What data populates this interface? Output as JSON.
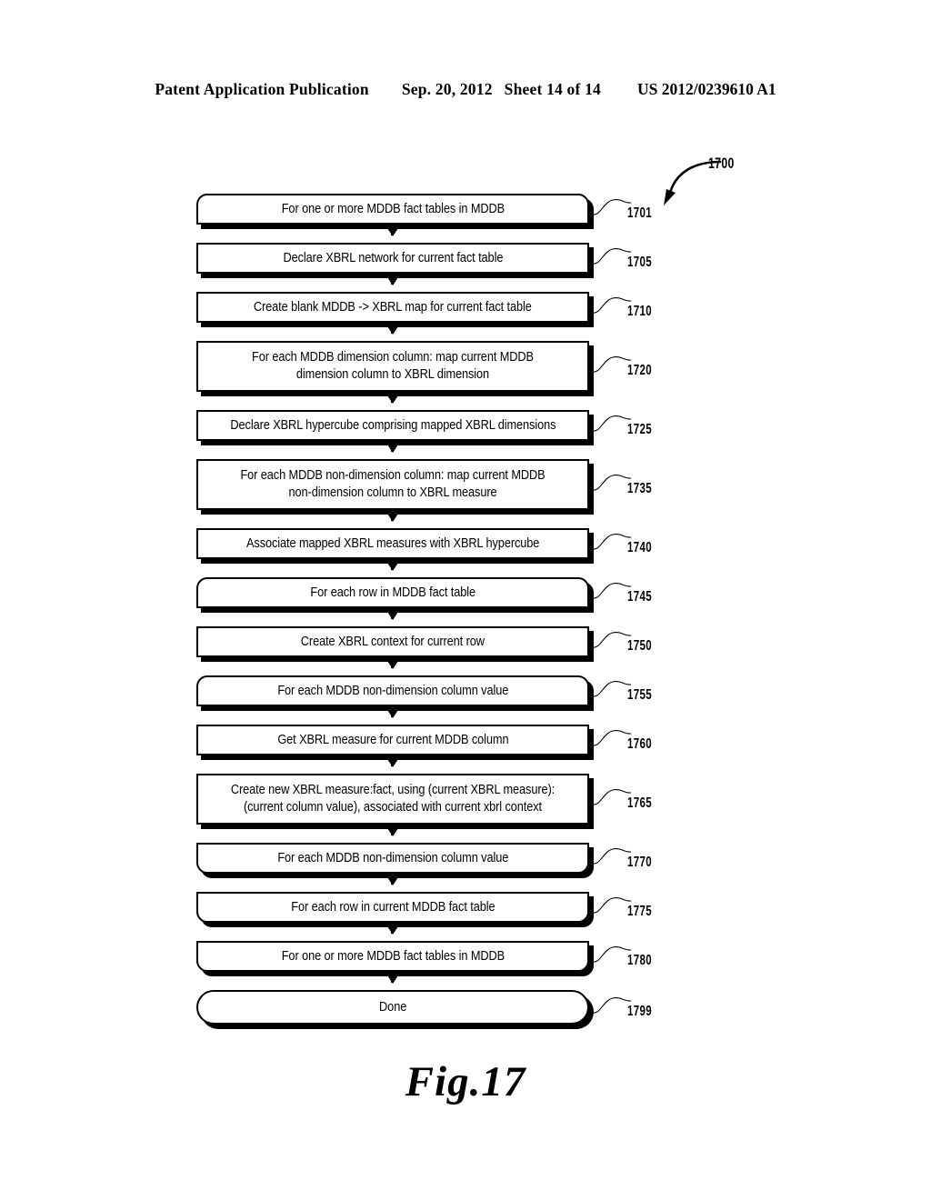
{
  "header": {
    "publication": "Patent Application Publication",
    "date": "Sep. 20, 2012",
    "sheet": "Sheet 14 of 14",
    "patent_number": "US 2012/0239610 A1"
  },
  "figure": {
    "caption": "Fig.17",
    "diagram_ref": "1700"
  },
  "flowchart": {
    "nodes": [
      {
        "ref": "1701",
        "shape": "loopstart",
        "text": "For one or more MDDB fact tables in MDDB"
      },
      {
        "ref": "1705",
        "shape": "rect",
        "text": "Declare XBRL network for current fact table"
      },
      {
        "ref": "1710",
        "shape": "rect",
        "text": "Create blank MDDB -> XBRL map for current fact table"
      },
      {
        "ref": "1720",
        "shape": "rect",
        "text": "For each MDDB dimension column: map current MDDB dimension column to XBRL dimension"
      },
      {
        "ref": "1725",
        "shape": "rect",
        "text": "Declare XBRL hypercube comprising mapped XBRL dimensions"
      },
      {
        "ref": "1735",
        "shape": "rect",
        "text": "For each MDDB non-dimension column: map current MDDB non-dimension column to XBRL measure"
      },
      {
        "ref": "1740",
        "shape": "rect",
        "text": "Associate mapped XBRL measures with XBRL hypercube"
      },
      {
        "ref": "1745",
        "shape": "loopstart",
        "text": "For each row in MDDB fact table"
      },
      {
        "ref": "1750",
        "shape": "rect",
        "text": "Create XBRL context for current row"
      },
      {
        "ref": "1755",
        "shape": "loopstart",
        "text": "For each MDDB non-dimension column value"
      },
      {
        "ref": "1760",
        "shape": "rect",
        "text": "Get XBRL measure for current MDDB column"
      },
      {
        "ref": "1765",
        "shape": "rect",
        "text": "Create new XBRL measure:fact, using (current XBRL measure):(current column value), associated with current xbrl context"
      },
      {
        "ref": "1770",
        "shape": "loopend",
        "text": "For each MDDB non-dimension column value"
      },
      {
        "ref": "1775",
        "shape": "loopend",
        "text": "For each row in current MDDB fact table"
      },
      {
        "ref": "1780",
        "shape": "loopend",
        "text": "For one or more MDDB fact tables in MDDB"
      },
      {
        "ref": "1799",
        "shape": "stadium",
        "text": "Done"
      }
    ]
  }
}
